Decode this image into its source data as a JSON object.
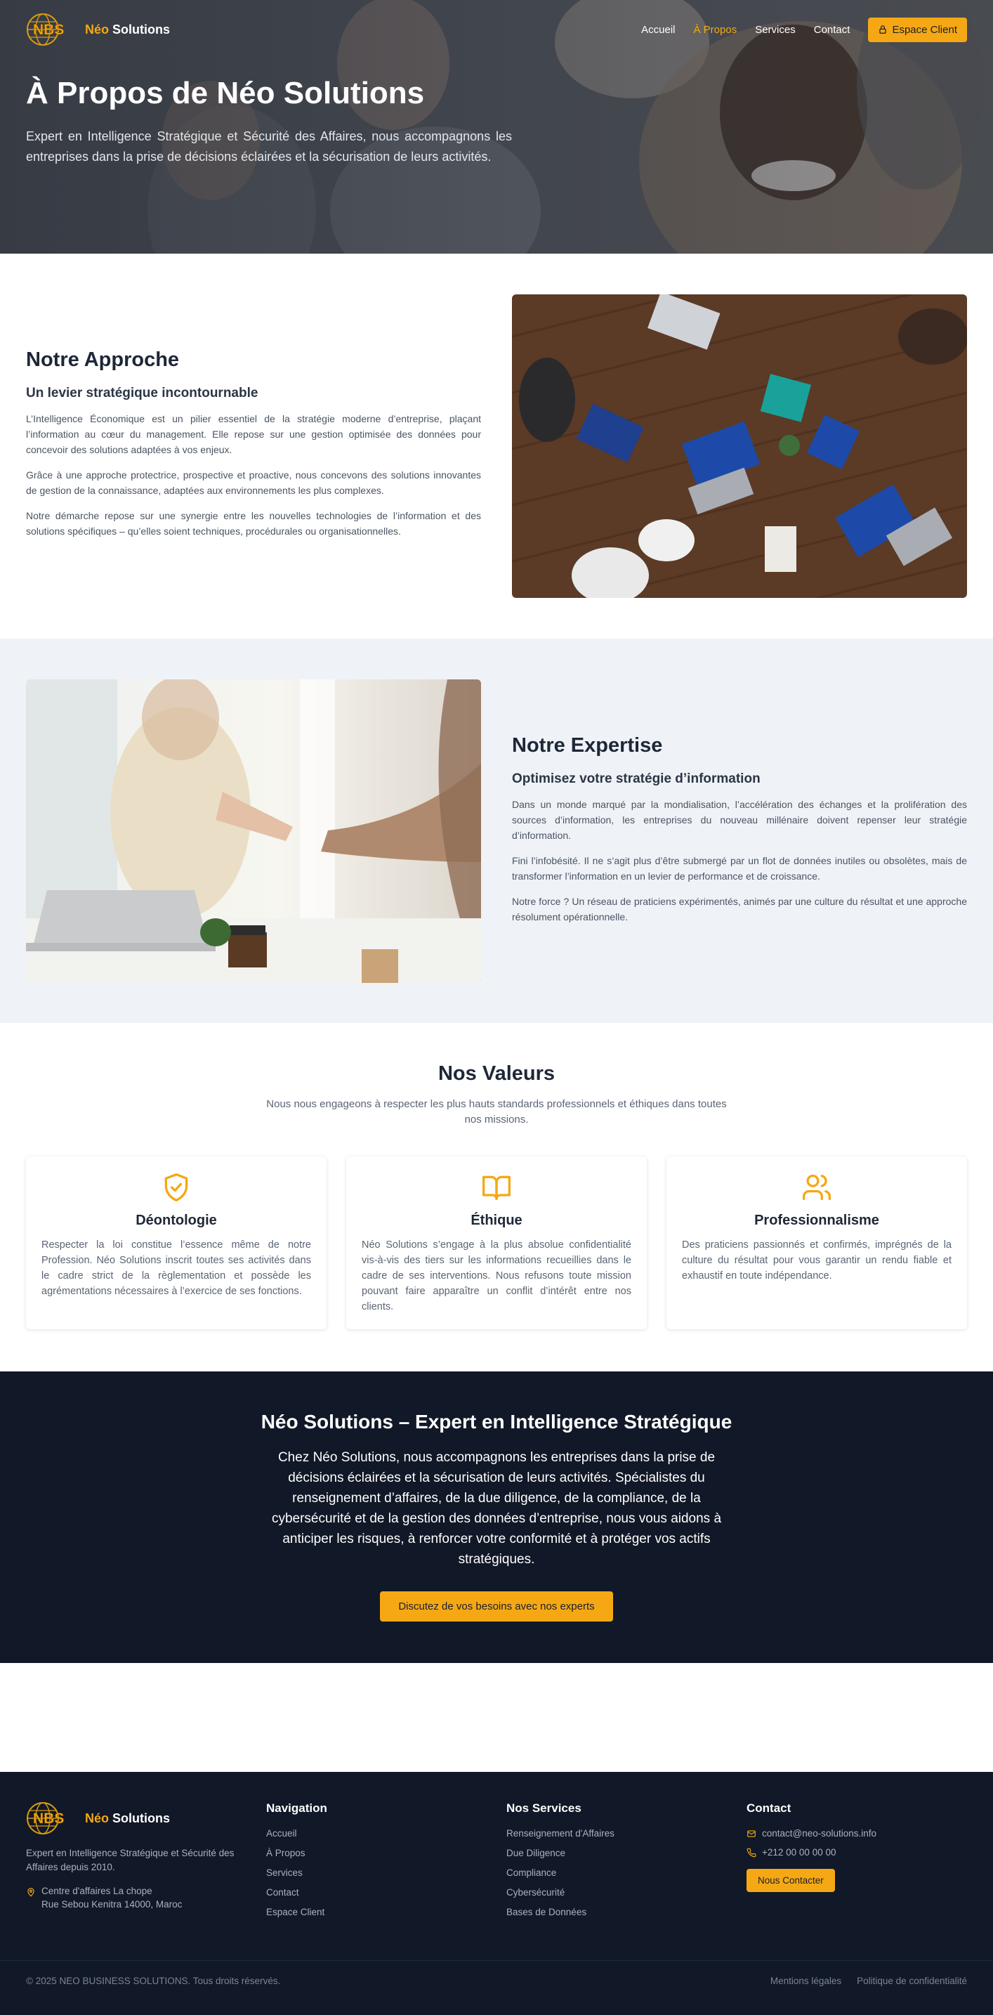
{
  "brand": {
    "abbr": "NBS",
    "name_part1": "Néo",
    "name_part2": "Solutions"
  },
  "nav": {
    "items": [
      {
        "label": "Accueil",
        "active": false
      },
      {
        "label": "À Propos",
        "active": true
      },
      {
        "label": "Services",
        "active": false
      },
      {
        "label": "Contact",
        "active": false
      }
    ],
    "client_button": "Espace Client"
  },
  "hero": {
    "title": "À Propos de Néo Solutions",
    "subtitle": "Expert en Intelligence Stratégique et Sécurité des Affaires, nous accompagnons les entreprises dans la prise de décisions éclairées et la sécurisation de leurs activités."
  },
  "approach": {
    "title": "Notre Approche",
    "subtitle": "Un levier stratégique incontournable",
    "paragraphs": [
      "L’Intelligence Économique est un pilier essentiel de la stratégie moderne d’entreprise, plaçant l’information au cœur du management. Elle repose sur une gestion optimisée des données pour concevoir des solutions adaptées à vos enjeux.",
      "Grâce à une approche protectrice, prospective et proactive, nous concevons des solutions innovantes de gestion de la connaissance, adaptées aux environnements les plus complexes.",
      "Notre démarche repose sur une synergie entre les nouvelles technologies de l’information et des solutions spécifiques – qu’elles soient techniques, procédurales ou organisationnelles."
    ]
  },
  "expertise": {
    "title": "Notre Expertise",
    "subtitle": "Optimisez votre stratégie d’information",
    "paragraphs": [
      "Dans un monde marqué par la mondialisation, l’accélération des échanges et la prolifération des sources d’information, les entreprises du nouveau millénaire doivent repenser leur stratégie d’information.",
      "Fini l’infobésité. Il ne s’agit plus d’être submergé par un flot de données inutiles ou obsolètes, mais de transformer l’information en un levier de performance et de croissance.",
      "Notre force ? Un réseau de praticiens expérimentés, animés par une culture du résultat et une approche résolument opérationnelle."
    ]
  },
  "values": {
    "title": "Nos Valeurs",
    "intro": "Nous nous engageons à respecter les plus hauts standards professionnels et éthiques dans toutes nos missions.",
    "cards": [
      {
        "icon": "shield-check-icon",
        "title": "Déontologie",
        "text": "Respecter la loi constitue l’essence même de notre Profession. Néo Solutions inscrit toutes ses activités dans le cadre strict de la règlementation et possède les agrémentations nécessaires à l’exercice de ses fonctions."
      },
      {
        "icon": "book-open-icon",
        "title": "Éthique",
        "text": "Néo Solutions s’engage à la plus absolue confidentialité vis-à-vis des tiers sur les informations recueillies dans le cadre de ses interventions. Nous refusons toute mission pouvant faire apparaître un conflit d’intérêt entre nos clients."
      },
      {
        "icon": "users-icon",
        "title": "Professionnalisme",
        "text": "Des praticiens passionnés et confirmés, imprégnés de la culture du résultat pour vous garantir un rendu fiable et exhaustif en toute indépendance."
      }
    ]
  },
  "cta": {
    "title": "Néo Solutions – Expert en Intelligence Stratégique",
    "text": "Chez Néo Solutions, nous accompagnons les entreprises dans la prise de décisions éclairées et la sécurisation de leurs activités. Spécialistes du renseignement d’affaires, de la due diligence, de la compliance, de la cybersécurité et de la gestion des données d’entreprise, nous vous aidons à anticiper les risques, à renforcer votre conformité et à protéger vos actifs stratégiques.",
    "button": "Discutez de vos besoins avec nos experts"
  },
  "footer": {
    "description": "Expert en Intelligence Stratégique et Sécurité des Affaires depuis 2010.",
    "address_line1": "Centre d'affaires La chope",
    "address_line2": "Rue Sebou Kenitra 14000, Maroc",
    "nav_title": "Navigation",
    "nav_links": [
      "Accueil",
      "À Propos",
      "Services",
      "Contact",
      "Espace Client"
    ],
    "services_title": "Nos Services",
    "services_links": [
      "Renseignement d'Affaires",
      "Due Diligence",
      "Compliance",
      "Cybersécurité",
      "Bases de Données"
    ],
    "contact_title": "Contact",
    "email": "contact@neo-solutions.info",
    "phone": "+212 00 00 00 00",
    "contact_button": "Nous Contacter",
    "copyright": "© 2025 NEO BUSINESS SOLUTIONS. Tous droits réservés.",
    "legal_links": [
      "Mentions légales",
      "Politique de confidentialité"
    ]
  },
  "colors": {
    "accent": "#f5a814",
    "dark": "#111827",
    "light_bg": "#eff3f8",
    "text": "#1e2737"
  }
}
